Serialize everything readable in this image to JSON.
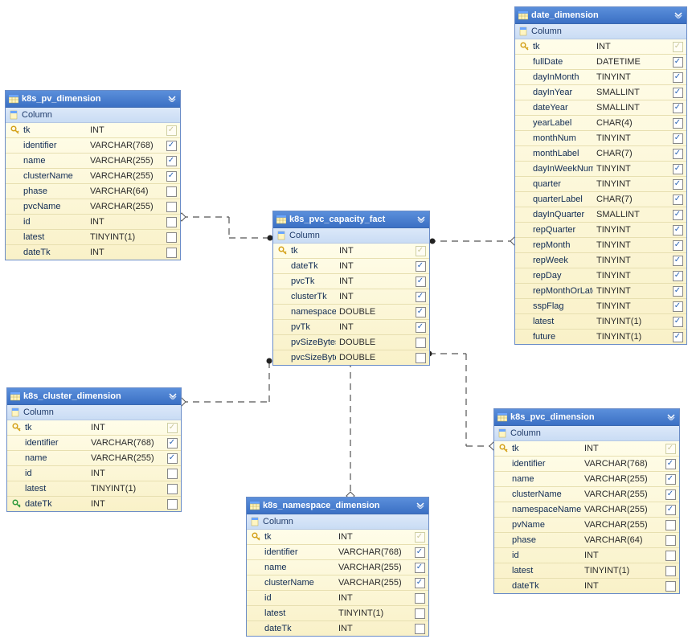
{
  "section_label": "Column",
  "tables": {
    "pv_dim": {
      "title": "k8s_pv_dimension",
      "columns": [
        {
          "icon": "pk",
          "name": "tk",
          "type": "INT",
          "checked": "soft"
        },
        {
          "icon": "",
          "name": "identifier",
          "type": "VARCHAR(768)",
          "checked": true
        },
        {
          "icon": "",
          "name": "name",
          "type": "VARCHAR(255)",
          "checked": true
        },
        {
          "icon": "",
          "name": "clusterName",
          "type": "VARCHAR(255)",
          "checked": true
        },
        {
          "icon": "",
          "name": "phase",
          "type": "VARCHAR(64)",
          "checked": false
        },
        {
          "icon": "",
          "name": "pvcName",
          "type": "VARCHAR(255)",
          "checked": false
        },
        {
          "icon": "",
          "name": "id",
          "type": "INT",
          "checked": false
        },
        {
          "icon": "",
          "name": "latest",
          "type": "TINYINT(1)",
          "checked": false
        },
        {
          "icon": "",
          "name": "dateTk",
          "type": "INT",
          "checked": false
        }
      ]
    },
    "pvc_fact": {
      "title": "k8s_pvc_capacity_fact",
      "columns": [
        {
          "icon": "pk",
          "name": "tk",
          "type": "INT",
          "checked": "soft"
        },
        {
          "icon": "",
          "name": "dateTk",
          "type": "INT",
          "checked": true
        },
        {
          "icon": "",
          "name": "pvcTk",
          "type": "INT",
          "checked": true
        },
        {
          "icon": "",
          "name": "clusterTk",
          "type": "INT",
          "checked": true
        },
        {
          "icon": "",
          "name": "namespaceTk",
          "type": "DOUBLE",
          "checked": true
        },
        {
          "icon": "",
          "name": "pvTk",
          "type": "INT",
          "checked": true
        },
        {
          "icon": "",
          "name": "pvSizeBytes",
          "type": "DOUBLE",
          "checked": false
        },
        {
          "icon": "",
          "name": "pvcSizeBytes",
          "type": "DOUBLE",
          "checked": false
        }
      ]
    },
    "cluster_dim": {
      "title": "k8s_cluster_dimension",
      "columns": [
        {
          "icon": "pk",
          "name": "tk",
          "type": "INT",
          "checked": "soft"
        },
        {
          "icon": "",
          "name": "identifier",
          "type": "VARCHAR(768)",
          "checked": true
        },
        {
          "icon": "",
          "name": "name",
          "type": "VARCHAR(255)",
          "checked": true
        },
        {
          "icon": "",
          "name": "id",
          "type": "INT",
          "checked": false
        },
        {
          "icon": "",
          "name": "latest",
          "type": "TINYINT(1)",
          "checked": false
        },
        {
          "icon": "pk-green",
          "name": "dateTk",
          "type": "INT",
          "checked": false
        }
      ]
    },
    "ns_dim": {
      "title": "k8s_namespace_dimension",
      "columns": [
        {
          "icon": "pk",
          "name": "tk",
          "type": "INT",
          "checked": "soft"
        },
        {
          "icon": "",
          "name": "identifier",
          "type": "VARCHAR(768)",
          "checked": true
        },
        {
          "icon": "",
          "name": "name",
          "type": "VARCHAR(255)",
          "checked": true
        },
        {
          "icon": "",
          "name": "clusterName",
          "type": "VARCHAR(255)",
          "checked": true
        },
        {
          "icon": "",
          "name": "id",
          "type": "INT",
          "checked": false
        },
        {
          "icon": "",
          "name": "latest",
          "type": "TINYINT(1)",
          "checked": false
        },
        {
          "icon": "",
          "name": "dateTk",
          "type": "INT",
          "checked": false
        }
      ]
    },
    "pvc_dim": {
      "title": "k8s_pvc_dimension",
      "columns": [
        {
          "icon": "pk",
          "name": "tk",
          "type": "INT",
          "checked": "soft"
        },
        {
          "icon": "",
          "name": "identifier",
          "type": "VARCHAR(768)",
          "checked": true
        },
        {
          "icon": "",
          "name": "name",
          "type": "VARCHAR(255)",
          "checked": true
        },
        {
          "icon": "",
          "name": "clusterName",
          "type": "VARCHAR(255)",
          "checked": true
        },
        {
          "icon": "",
          "name": "namespaceName",
          "type": "VARCHAR(255)",
          "checked": true
        },
        {
          "icon": "",
          "name": "pvName",
          "type": "VARCHAR(255)",
          "checked": false
        },
        {
          "icon": "",
          "name": "phase",
          "type": "VARCHAR(64)",
          "checked": false
        },
        {
          "icon": "",
          "name": "id",
          "type": "INT",
          "checked": false
        },
        {
          "icon": "",
          "name": "latest",
          "type": "TINYINT(1)",
          "checked": false
        },
        {
          "icon": "",
          "name": "dateTk",
          "type": "INT",
          "checked": false
        }
      ]
    },
    "date_dim": {
      "title": "date_dimension",
      "columns": [
        {
          "icon": "pk",
          "name": "tk",
          "type": "INT",
          "checked": "soft"
        },
        {
          "icon": "",
          "name": "fullDate",
          "type": "DATETIME",
          "checked": true
        },
        {
          "icon": "",
          "name": "dayInMonth",
          "type": "TINYINT",
          "checked": true
        },
        {
          "icon": "",
          "name": "dayInYear",
          "type": "SMALLINT",
          "checked": true
        },
        {
          "icon": "",
          "name": "dateYear",
          "type": "SMALLINT",
          "checked": true
        },
        {
          "icon": "",
          "name": "yearLabel",
          "type": "CHAR(4)",
          "checked": true
        },
        {
          "icon": "",
          "name": "monthNum",
          "type": "TINYINT",
          "checked": true
        },
        {
          "icon": "",
          "name": "monthLabel",
          "type": "CHAR(7)",
          "checked": true
        },
        {
          "icon": "",
          "name": "dayInWeekNum",
          "type": "TINYINT",
          "checked": true
        },
        {
          "icon": "",
          "name": "quarter",
          "type": "TINYINT",
          "checked": true
        },
        {
          "icon": "",
          "name": "quarterLabel",
          "type": "CHAR(7)",
          "checked": true
        },
        {
          "icon": "",
          "name": "dayInQuarter",
          "type": "SMALLINT",
          "checked": true
        },
        {
          "icon": "",
          "name": "repQuarter",
          "type": "TINYINT",
          "checked": true
        },
        {
          "icon": "",
          "name": "repMonth",
          "type": "TINYINT",
          "checked": true
        },
        {
          "icon": "",
          "name": "repWeek",
          "type": "TINYINT",
          "checked": true
        },
        {
          "icon": "",
          "name": "repDay",
          "type": "TINYINT",
          "checked": true
        },
        {
          "icon": "",
          "name": "repMonthOrLatest",
          "type": "TINYINT",
          "checked": true
        },
        {
          "icon": "",
          "name": "sspFlag",
          "type": "TINYINT",
          "checked": true
        },
        {
          "icon": "",
          "name": "latest",
          "type": "TINYINT(1)",
          "checked": true
        },
        {
          "icon": "",
          "name": "future",
          "type": "TINYINT(1)",
          "checked": true
        }
      ]
    }
  }
}
